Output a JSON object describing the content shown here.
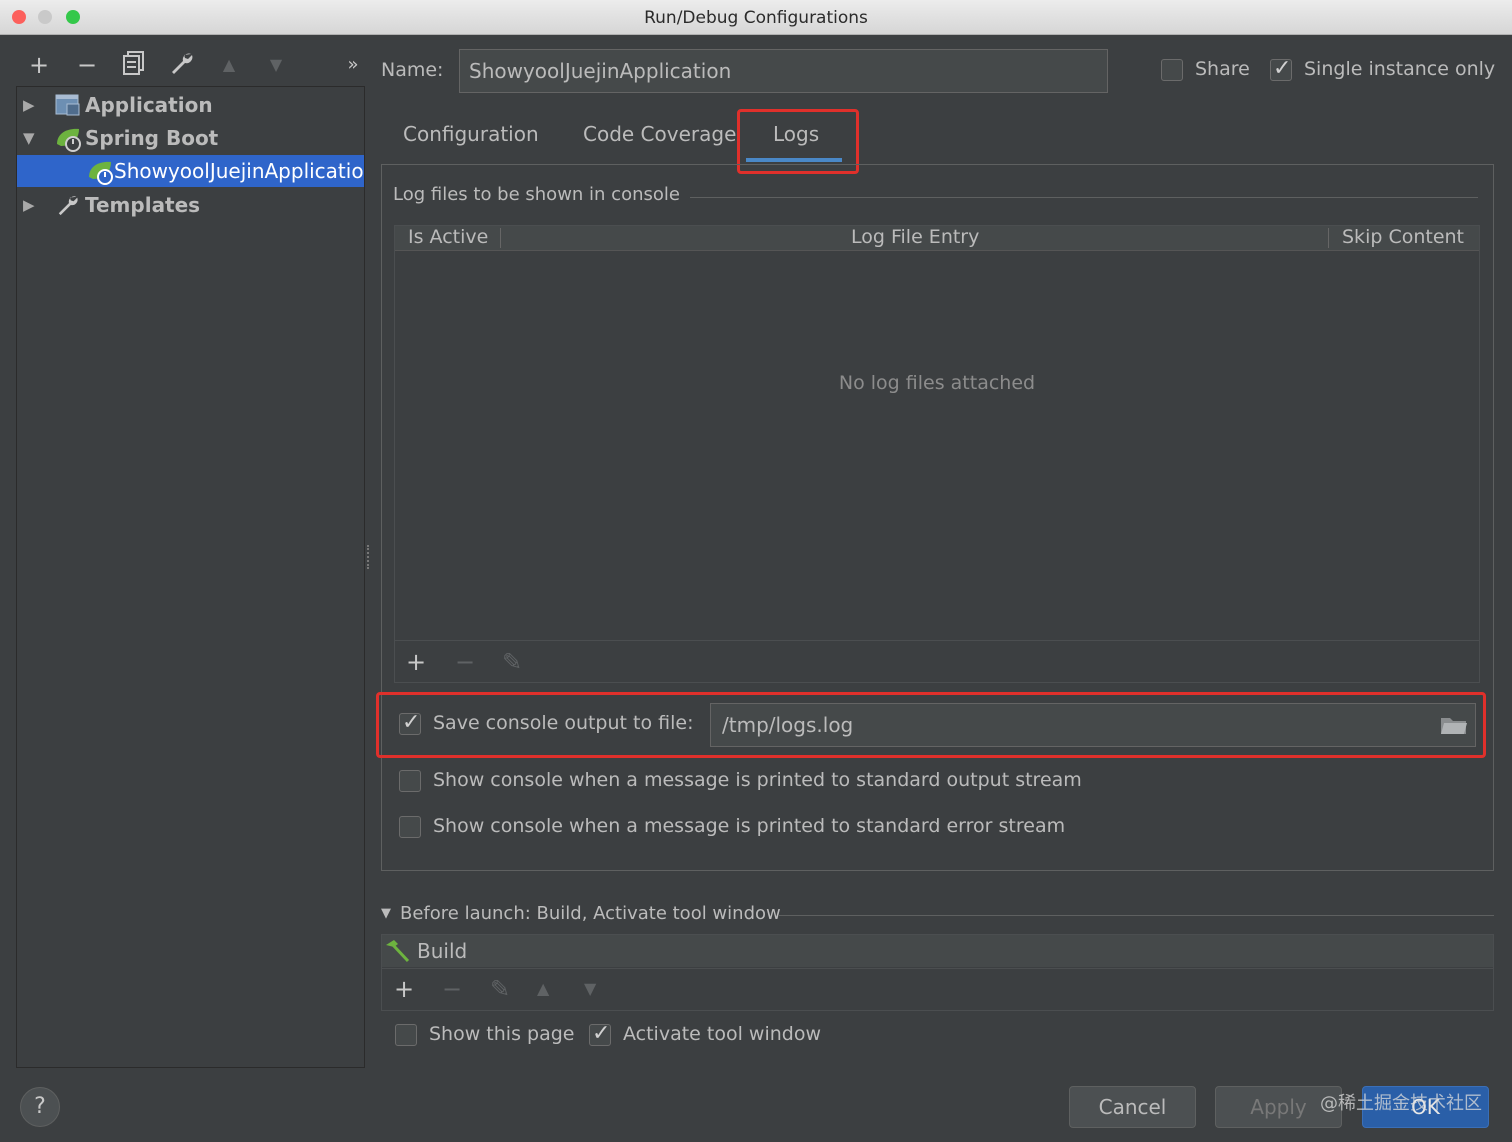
{
  "window": {
    "title": "Run/Debug Configurations"
  },
  "toolbar": {
    "add": "+",
    "remove": "−",
    "copy": "⧉",
    "edit": "🔧",
    "up": "▲",
    "down": "▼",
    "more": "»"
  },
  "tree": {
    "items": [
      {
        "label": "Application",
        "arrow": "▶"
      },
      {
        "label": "Spring Boot",
        "arrow": "▼"
      },
      {
        "label": "ShowyoolJuejinApplication"
      },
      {
        "label": "Templates",
        "arrow": "▶"
      }
    ]
  },
  "name": {
    "label": "Name:",
    "value": "ShowyoolJuejinApplication"
  },
  "share": {
    "label": "Share",
    "checked": false
  },
  "single_instance": {
    "label": "Single instance only",
    "checked": true
  },
  "tabs": [
    {
      "label": "Configuration"
    },
    {
      "label": "Code Coverage"
    },
    {
      "label": "Logs",
      "selected": true
    }
  ],
  "logs": {
    "section_title": "Log files to be shown in console",
    "columns": [
      "Is Active",
      "Log File Entry",
      "Skip Content"
    ],
    "empty_text": "No log files attached",
    "table_tools": {
      "add": "+",
      "remove": "−",
      "edit": "✎"
    },
    "save_output": {
      "label": "Save console output to file:",
      "checked": true,
      "value": "/tmp/logs.log"
    },
    "show_stdout": {
      "label": "Show console when a message is printed to standard output stream",
      "checked": false
    },
    "show_stderr": {
      "label": "Show console when a message is printed to standard error stream",
      "checked": false
    }
  },
  "before_launch": {
    "title": "Before launch: Build, Activate tool window",
    "items": [
      {
        "label": "Build"
      }
    ],
    "tools": {
      "add": "+",
      "remove": "−",
      "edit": "✎",
      "up": "▲",
      "down": "▼"
    },
    "show_page": {
      "label": "Show this page",
      "checked": false
    },
    "activate_window": {
      "label": "Activate tool window",
      "checked": true
    }
  },
  "buttons": {
    "help": "?",
    "cancel": "Cancel",
    "apply": "Apply",
    "ok": "OK"
  },
  "watermark": "@稀土掘金技术社区",
  "colors": {
    "selection": "#2f65ca",
    "highlight": "#e0302b",
    "background": "#3c3f41",
    "ok_button": "#2a5fa8"
  }
}
